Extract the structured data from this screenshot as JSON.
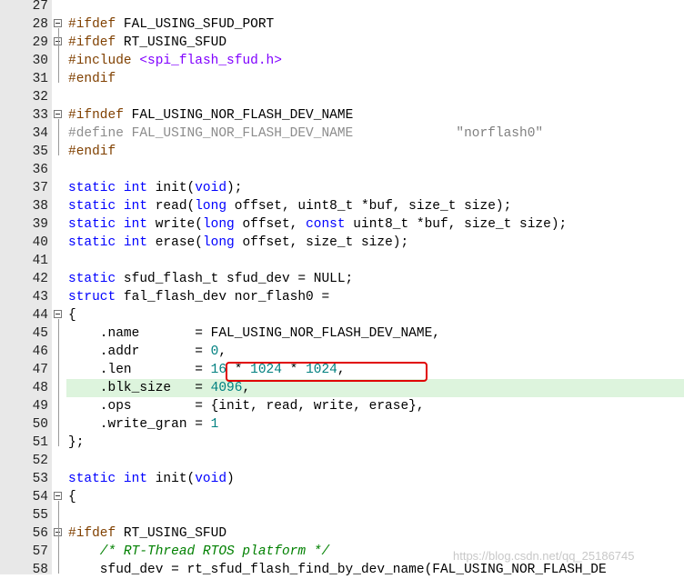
{
  "lines": [
    {
      "n": "27",
      "segments": [
        {
          "t": "",
          "c": "tok-op"
        }
      ]
    },
    {
      "n": "28",
      "fold": true,
      "segments": [
        {
          "t": "#ifdef ",
          "c": "tok-pp"
        },
        {
          "t": "FAL_USING_SFUD_PORT",
          "c": "tok-op"
        }
      ]
    },
    {
      "n": "29",
      "fold": true,
      "segments": [
        {
          "t": "#ifdef ",
          "c": "tok-pp"
        },
        {
          "t": "RT_USING_SFUD",
          "c": "tok-op"
        }
      ]
    },
    {
      "n": "30",
      "segments": [
        {
          "t": "#include ",
          "c": "tok-pp"
        },
        {
          "t": "<spi_flash_sfud.h>",
          "c": "tok-inc"
        }
      ]
    },
    {
      "n": "31",
      "segments": [
        {
          "t": "#endif",
          "c": "tok-pp"
        }
      ]
    },
    {
      "n": "32",
      "segments": [
        {
          "t": "",
          "c": "tok-op"
        }
      ]
    },
    {
      "n": "33",
      "fold": true,
      "segments": [
        {
          "t": "#ifndef ",
          "c": "tok-pp"
        },
        {
          "t": "FAL_USING_NOR_FLASH_DEV_NAME",
          "c": "tok-op"
        }
      ]
    },
    {
      "n": "34",
      "segments": [
        {
          "t": "#define FAL_USING_NOR_FLASH_DEV_NAME             ",
          "c": "tok-def-dim"
        },
        {
          "t": "\"norflash0\"",
          "c": "tok-str"
        }
      ]
    },
    {
      "n": "35",
      "segments": [
        {
          "t": "#endif",
          "c": "tok-pp"
        }
      ]
    },
    {
      "n": "36",
      "segments": [
        {
          "t": "",
          "c": "tok-op"
        }
      ]
    },
    {
      "n": "37",
      "segments": [
        {
          "t": "static int ",
          "c": "tok-kw"
        },
        {
          "t": "init(",
          "c": "tok-op"
        },
        {
          "t": "void",
          "c": "tok-kw"
        },
        {
          "t": ");",
          "c": "tok-op"
        }
      ]
    },
    {
      "n": "38",
      "segments": [
        {
          "t": "static int ",
          "c": "tok-kw"
        },
        {
          "t": "read(",
          "c": "tok-op"
        },
        {
          "t": "long ",
          "c": "tok-kw"
        },
        {
          "t": "offset, uint8_t *buf, size_t size);",
          "c": "tok-op"
        }
      ]
    },
    {
      "n": "39",
      "segments": [
        {
          "t": "static int ",
          "c": "tok-kw"
        },
        {
          "t": "write(",
          "c": "tok-op"
        },
        {
          "t": "long ",
          "c": "tok-kw"
        },
        {
          "t": "offset, ",
          "c": "tok-op"
        },
        {
          "t": "const ",
          "c": "tok-kw"
        },
        {
          "t": "uint8_t *buf, size_t size);",
          "c": "tok-op"
        }
      ]
    },
    {
      "n": "40",
      "segments": [
        {
          "t": "static int ",
          "c": "tok-kw"
        },
        {
          "t": "erase(",
          "c": "tok-op"
        },
        {
          "t": "long ",
          "c": "tok-kw"
        },
        {
          "t": "offset, size_t size);",
          "c": "tok-op"
        }
      ]
    },
    {
      "n": "41",
      "segments": [
        {
          "t": "",
          "c": "tok-op"
        }
      ]
    },
    {
      "n": "42",
      "segments": [
        {
          "t": "static ",
          "c": "tok-kw"
        },
        {
          "t": "sfud_flash_t sfud_dev = NULL;",
          "c": "tok-op"
        }
      ]
    },
    {
      "n": "43",
      "segments": [
        {
          "t": "struct ",
          "c": "tok-kw"
        },
        {
          "t": "fal_flash_dev nor_flash0 =",
          "c": "tok-op"
        }
      ]
    },
    {
      "n": "44",
      "fold": true,
      "segments": [
        {
          "t": "{",
          "c": "tok-op"
        }
      ]
    },
    {
      "n": "45",
      "segments": [
        {
          "t": "    .name       = FAL_USING_NOR_FLASH_DEV_NAME,",
          "c": "tok-op"
        }
      ]
    },
    {
      "n": "46",
      "segments": [
        {
          "t": "    .addr       = ",
          "c": "tok-op"
        },
        {
          "t": "0",
          "c": "tok-num"
        },
        {
          "t": ",",
          "c": "tok-op"
        }
      ]
    },
    {
      "n": "47",
      "segments": [
        {
          "t": "    .len        = ",
          "c": "tok-op"
        },
        {
          "t": "16",
          "c": "tok-num"
        },
        {
          "t": " * ",
          "c": "tok-op"
        },
        {
          "t": "1024",
          "c": "tok-num"
        },
        {
          "t": " * ",
          "c": "tok-op"
        },
        {
          "t": "1024",
          "c": "tok-num"
        },
        {
          "t": ",",
          "c": "tok-op"
        }
      ]
    },
    {
      "n": "48",
      "current": true,
      "segments": [
        {
          "t": "    .blk_size   = ",
          "c": "tok-op"
        },
        {
          "t": "4096",
          "c": "tok-num"
        },
        {
          "t": ",",
          "c": "tok-op"
        }
      ]
    },
    {
      "n": "49",
      "segments": [
        {
          "t": "    .ops        = {init, read, write, erase},",
          "c": "tok-op"
        }
      ]
    },
    {
      "n": "50",
      "segments": [
        {
          "t": "    .write_gran = ",
          "c": "tok-op"
        },
        {
          "t": "1",
          "c": "tok-num"
        }
      ]
    },
    {
      "n": "51",
      "segments": [
        {
          "t": "};",
          "c": "tok-op"
        }
      ]
    },
    {
      "n": "52",
      "segments": [
        {
          "t": "",
          "c": "tok-op"
        }
      ]
    },
    {
      "n": "53",
      "segments": [
        {
          "t": "static int ",
          "c": "tok-kw"
        },
        {
          "t": "init(",
          "c": "tok-op"
        },
        {
          "t": "void",
          "c": "tok-kw"
        },
        {
          "t": ")",
          "c": "tok-op"
        }
      ]
    },
    {
      "n": "54",
      "fold": true,
      "segments": [
        {
          "t": "{",
          "c": "tok-op"
        }
      ]
    },
    {
      "n": "55",
      "segments": [
        {
          "t": "",
          "c": "tok-op"
        }
      ]
    },
    {
      "n": "56",
      "fold": true,
      "segments": [
        {
          "t": "#ifdef ",
          "c": "tok-pp"
        },
        {
          "t": "RT_USING_SFUD",
          "c": "tok-op"
        }
      ]
    },
    {
      "n": "57",
      "segments": [
        {
          "t": "    /* RT-Thread RTOS platform */",
          "c": "tok-cm"
        }
      ]
    },
    {
      "n": "58",
      "segments": [
        {
          "t": "    sfud_dev = rt_sfud_flash_find_by_dev_name(FAL_USING_NOR_FLASH_DE",
          "c": "tok-op"
        }
      ]
    }
  ],
  "watermark": "https://blog.csdn.net/qq_25186745"
}
